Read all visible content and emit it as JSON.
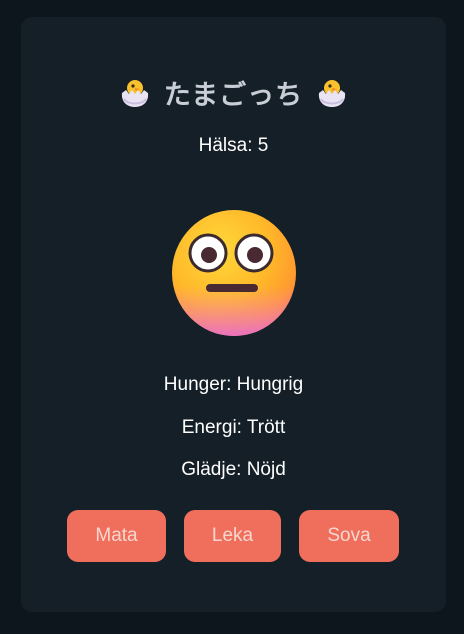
{
  "title": "たまごっち",
  "title_icon": "hatching-chick-icon",
  "health": "Hälsa: 5",
  "pet_face": "neutral-face-emoji",
  "stats": {
    "hunger": "Hunger: Hungrig",
    "energy": "Energi: Trött",
    "happiness": "Glädje: Nöjd"
  },
  "buttons": {
    "feed": "Mata",
    "play": "Leka",
    "sleep": "Sova"
  },
  "colors": {
    "background": "#0e161d",
    "card": "#141f27",
    "button": "#f06f5c",
    "button_text": "#f7d6cf"
  }
}
